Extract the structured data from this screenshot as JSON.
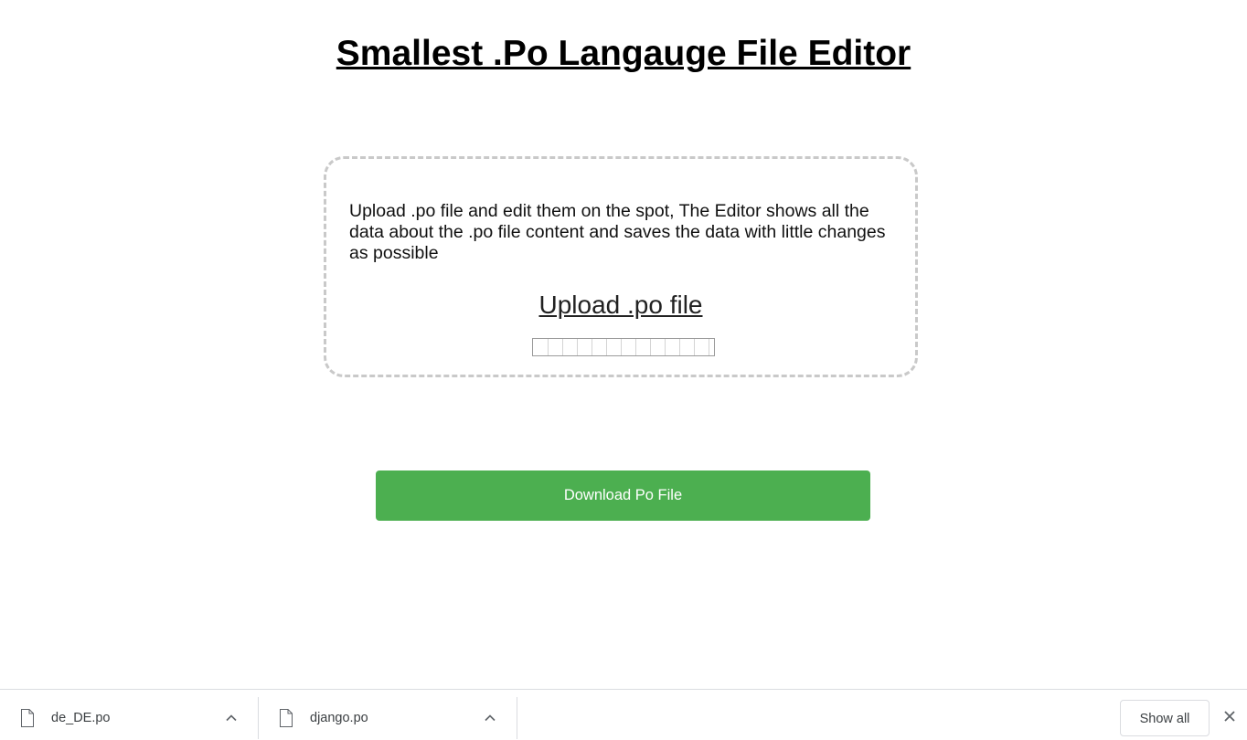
{
  "page": {
    "title": "Smallest .Po Langauge File Editor"
  },
  "upload": {
    "description": "Upload .po file and edit them on the spot, The Editor shows all the data about the .po file content and saves the data with little changes as possible",
    "link_label": "Upload .po file"
  },
  "actions": {
    "download_label": "Download Po File"
  },
  "colors": {
    "download_button": "#4caf50",
    "dashed_border": "#c9c9c9"
  },
  "download_shelf": {
    "items": [
      {
        "file_name": "de_DE.po",
        "icon": "file-icon",
        "menu_icon": "chevron-up-icon"
      },
      {
        "file_name": "django.po",
        "icon": "file-icon",
        "menu_icon": "chevron-up-icon"
      }
    ],
    "show_all_label": "Show all",
    "close_icon": "close-icon"
  }
}
